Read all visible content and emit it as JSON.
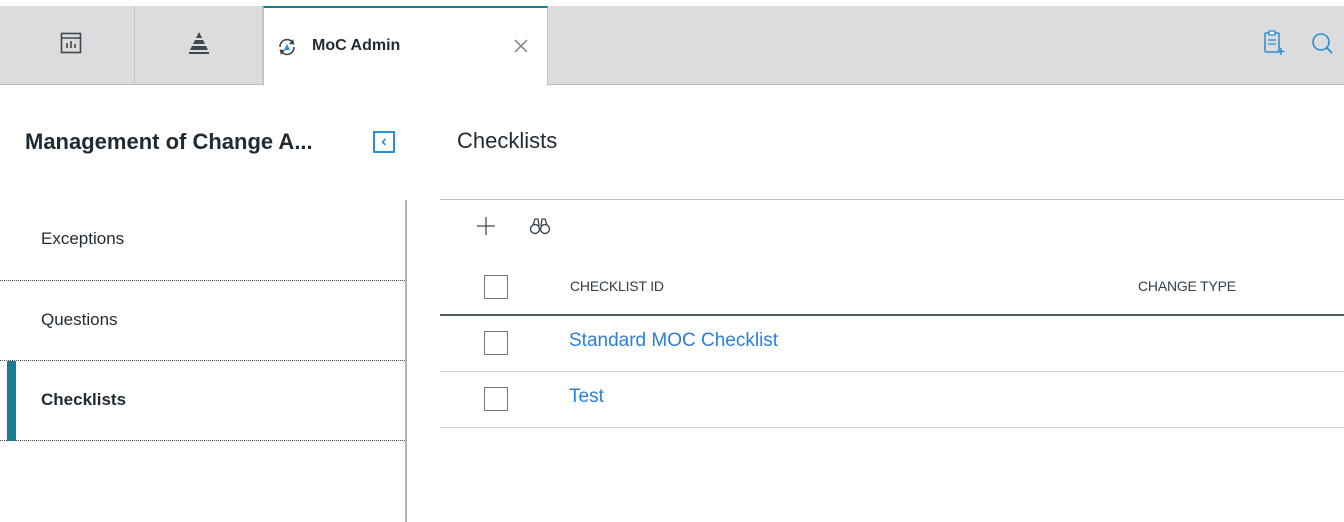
{
  "tabs": {
    "active": {
      "title": "MoC Admin",
      "icon": "moc-sync-icon",
      "close_icon": "close-icon"
    },
    "icon_tabs": [
      "dashboard-icon",
      "hierarchy-icon"
    ],
    "tools": [
      "new-record-icon",
      "search-icon"
    ]
  },
  "panel": {
    "title": "Management of Change A...",
    "collapse_icon": "chevron-left-icon",
    "items": [
      {
        "label": "Exceptions"
      },
      {
        "label": "Questions"
      },
      {
        "label": "Checklists",
        "active": true
      }
    ]
  },
  "content": {
    "title": "Checklists",
    "toolbar": [
      "add-icon",
      "binoculars-icon"
    ],
    "columns": {
      "checklist_id": "CHECKLIST ID",
      "change_type": "CHANGE TYPE"
    },
    "rows": [
      {
        "checklist_id": "Standard MOC Checklist",
        "change_type": ""
      },
      {
        "checklist_id": "Test",
        "change_type": ""
      }
    ]
  },
  "colors": {
    "accent": "#1a7c91",
    "link": "#2a7fd8",
    "tabbar": "#dcdcdc"
  }
}
